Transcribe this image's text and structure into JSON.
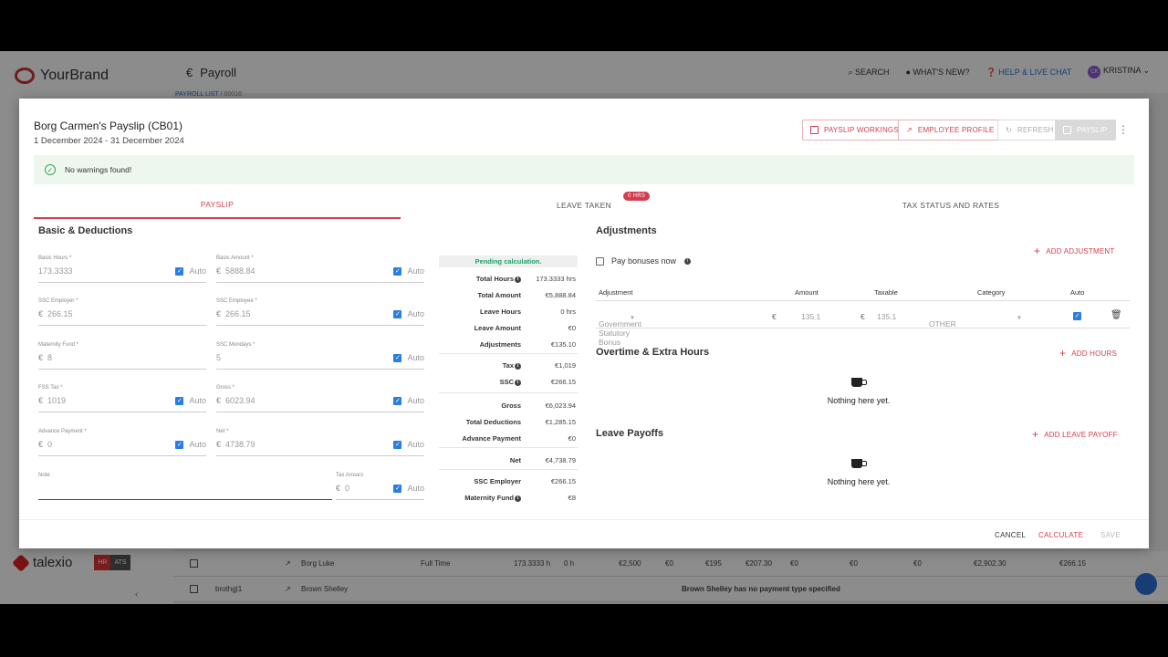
{
  "background": {
    "brand": "YourBrand",
    "page_title": "Payroll",
    "search": "SEARCH",
    "whats_new": "WHAT'S NEW?",
    "help": "HELP & LIVE CHAT",
    "user_initials": "CK",
    "user": "KRISTINA",
    "breadcrumb_list": "PAYROLL LIST",
    "breadcrumb_sep": "/",
    "breadcrumb_id": "00016",
    "footer_brand": "talexio",
    "module_hr": "HR",
    "module_ats": "ATS",
    "rows": [
      {
        "name": "Borg Luke",
        "type": "Full Time",
        "hours": "173.3333 h",
        "h2": "0 h",
        "c1": "€2,500",
        "c2": "€0",
        "c3": "€195",
        "c4": "€207.30",
        "c5": "€0",
        "c6": "€0",
        "c7": "€0",
        "c8": "€2,902.30",
        "c9": "€266.15"
      },
      {
        "code": "brothg|1",
        "name": "Brown Shelley",
        "message": "Brown Shelley has no payment type specified"
      }
    ]
  },
  "modal": {
    "title": "Borg Carmen's Payslip (CB01)",
    "period": "1 December 2024 - 31 December 2024",
    "buttons": {
      "workings": "PAYSLIP WORKINGS",
      "profile": "EMPLOYEE PROFILE",
      "refresh": "REFRESH",
      "payslip": "PAYSLIP"
    },
    "warning": "No warnings found!",
    "tabs": {
      "payslip": "PAYSLIP",
      "leave": "LEAVE TAKEN",
      "leave_badge": "0 HRS",
      "tax": "TAX STATUS AND RATES"
    },
    "basic": {
      "title": "Basic & Deductions",
      "auto": "Auto",
      "currency": "€",
      "basic_hours_label": "Basic Hours *",
      "basic_hours": "173.3333",
      "basic_amount_label": "Basic Amount *",
      "basic_amount": "5888.84",
      "ssc_employer_label": "SSC Employer *",
      "ssc_employer": "266.15",
      "ssc_employee_label": "SSC Employee *",
      "ssc_employee": "266.15",
      "maternity_label": "Maternity Fund *",
      "maternity": "8",
      "ssc_mondays_label": "SSC Mondays *",
      "ssc_mondays": "5",
      "fss_tax_label": "FSS Tax *",
      "fss_tax": "1019",
      "gross_label": "Gross *",
      "gross": "6023.94",
      "advance_label": "Advance Payment *",
      "advance": "0",
      "net_label": "Net *",
      "net": "4738.79",
      "note_label": "Note",
      "tax_arrears_label": "Tax Arrears",
      "tax_arrears": "0"
    },
    "summary": {
      "status": "Pending calculation.",
      "total_hours_label": "Total Hours",
      "total_hours": "173.3333 hrs",
      "total_amount_label": "Total Amount",
      "total_amount": "€5,888.84",
      "leave_hours_label": "Leave Hours",
      "leave_hours": "0 hrs",
      "leave_amount_label": "Leave Amount",
      "leave_amount": "€0",
      "adjustments_label": "Adjustments",
      "adjustments": "€135.10",
      "tax_label": "Tax",
      "tax": "€1,019",
      "ssc_label": "SSC",
      "ssc": "€266.15",
      "gross_label": "Gross",
      "gross": "€6,023.94",
      "total_deductions_label": "Total Deductions",
      "total_deductions": "€1,285.15",
      "advance_label": "Advance Payment",
      "advance": "€0",
      "net_label": "Net",
      "net": "€4,738.79",
      "ssc_employer_label": "SSC Employer",
      "ssc_employer": "€266.15",
      "maternity_label": "Maternity Fund",
      "maternity": "€8"
    },
    "adjustments": {
      "title": "Adjustments",
      "add": "ADD ADJUSTMENT",
      "pay_bonuses": "Pay bonuses now",
      "headers": {
        "adjustment": "Adjustment",
        "amount": "Amount",
        "taxable": "Taxable",
        "category": "Category",
        "auto": "Auto"
      },
      "row": {
        "name": "Government Statutory Bonus",
        "currency": "€",
        "amount": "135.1",
        "taxable": "135.1",
        "category": "OTHER"
      }
    },
    "overtime": {
      "title": "Overtime & Extra Hours",
      "add": "ADD HOURS",
      "empty": "Nothing here yet."
    },
    "leave_payoffs": {
      "title": "Leave Payoffs",
      "add": "ADD LEAVE PAYOFF",
      "empty": "Nothing here yet."
    },
    "footer": {
      "cancel": "CANCEL",
      "calculate": "CALCULATE",
      "save": "SAVE"
    }
  }
}
